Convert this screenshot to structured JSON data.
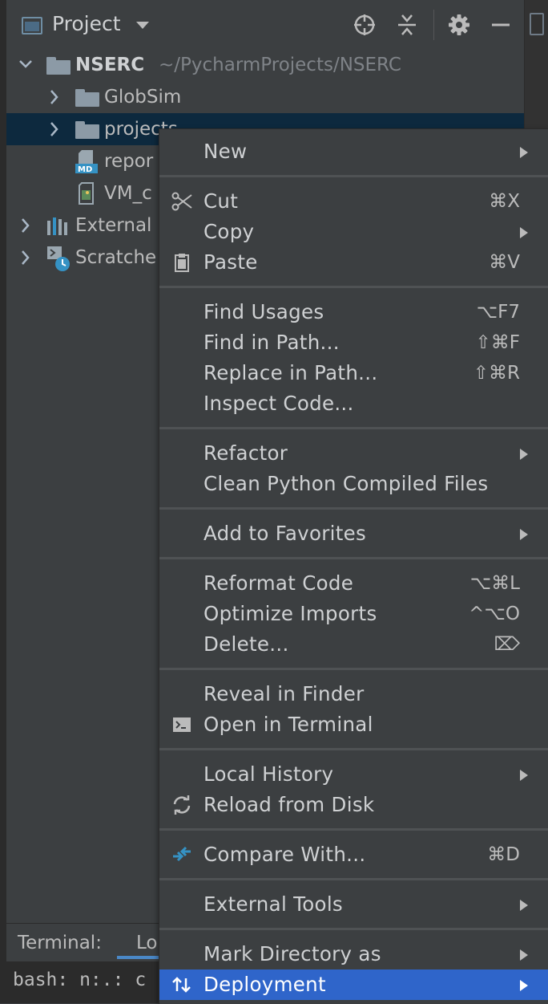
{
  "header": {
    "title": "Project",
    "icons": [
      "project-view-icon",
      "locate-icon",
      "collapse-all-icon",
      "gear-icon",
      "minimize-icon"
    ]
  },
  "tree": {
    "root": {
      "name": "NSERC",
      "path": "~/PycharmProjects/NSERC"
    },
    "children": [
      {
        "label": "GlobSim",
        "icon": "folder-icon"
      },
      {
        "label": "projects",
        "icon": "folder-icon",
        "selected": true
      },
      {
        "label": "repor",
        "icon": "markdown-file-icon"
      },
      {
        "label": "VM_c",
        "icon": "image-file-icon"
      }
    ],
    "external": "External",
    "scratches": "Scratche"
  },
  "terminal": {
    "label": "Terminal:",
    "tab": "Lo",
    "line": "bash: n:.: c"
  },
  "menu": {
    "items": [
      {
        "label": "New",
        "shortcut": "",
        "submenu": true
      },
      {
        "label": "Cut",
        "shortcut": "⌘X",
        "icon": "scissors-icon"
      },
      {
        "label": "Copy",
        "shortcut": "",
        "submenu": true
      },
      {
        "label": "Paste",
        "shortcut": "⌘V",
        "icon": "clipboard-icon"
      },
      {
        "label": "Find Usages",
        "shortcut": "⌥F7"
      },
      {
        "label": "Find in Path...",
        "shortcut": "⇧⌘F"
      },
      {
        "label": "Replace in Path...",
        "shortcut": "⇧⌘R"
      },
      {
        "label": "Inspect Code...",
        "shortcut": ""
      },
      {
        "label": "Refactor",
        "shortcut": "",
        "submenu": true
      },
      {
        "label": "Clean Python Compiled Files",
        "shortcut": ""
      },
      {
        "label": "Add to Favorites",
        "shortcut": "",
        "submenu": true
      },
      {
        "label": "Reformat Code",
        "shortcut": "⌥⌘L"
      },
      {
        "label": "Optimize Imports",
        "shortcut": "^⌥O"
      },
      {
        "label": "Delete...",
        "shortcut": "⌦"
      },
      {
        "label": "Reveal in Finder",
        "shortcut": ""
      },
      {
        "label": "Open in Terminal",
        "shortcut": "",
        "icon": "terminal-icon"
      },
      {
        "label": "Local History",
        "shortcut": "",
        "submenu": true
      },
      {
        "label": "Reload from Disk",
        "shortcut": "",
        "icon": "reload-icon"
      },
      {
        "label": "Compare With...",
        "shortcut": "⌘D",
        "icon": "compare-icon"
      },
      {
        "label": "External Tools",
        "shortcut": "",
        "submenu": true
      },
      {
        "label": "Mark Directory as",
        "shortcut": "",
        "submenu": true
      },
      {
        "label": "Deployment",
        "shortcut": "",
        "submenu": true,
        "icon": "deployment-icon",
        "highlighted": true
      }
    ]
  },
  "colors": {
    "background": "#3c3f41",
    "selection": "#0d293e",
    "highlight": "#2f65ca",
    "accent_blue": "#3592c4"
  }
}
